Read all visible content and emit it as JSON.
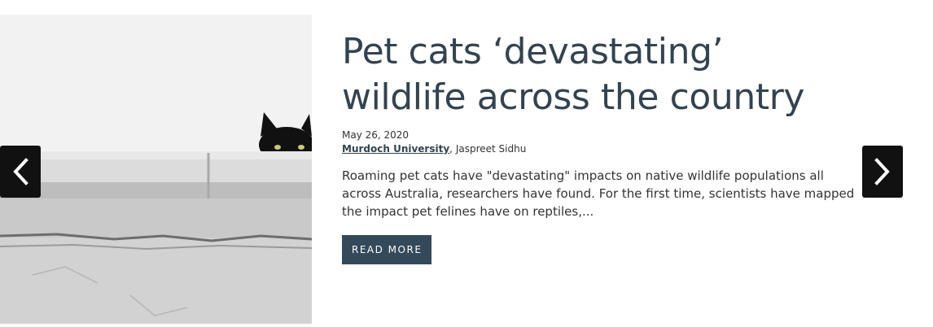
{
  "article": {
    "title": "Pet cats ‘devastating’ wildlife across the country",
    "date": "May 26, 2020",
    "organization": "Murdoch University",
    "author_separator": ", ",
    "author": "Jaspreet Sidhu",
    "excerpt": "Roaming pet cats have \"devastating\" impacts on native wildlife populations all across Australia, researchers have found. For the first time, scientists have mapped the impact pet felines have on reptiles,...",
    "read_more_label": "READ MORE"
  },
  "controls": {
    "prev_icon": "chevron-left-icon",
    "next_icon": "chevron-right-icon"
  },
  "colors": {
    "title": "#33434f",
    "button_bg": "#34495a",
    "arrow_bg": "#111111"
  }
}
